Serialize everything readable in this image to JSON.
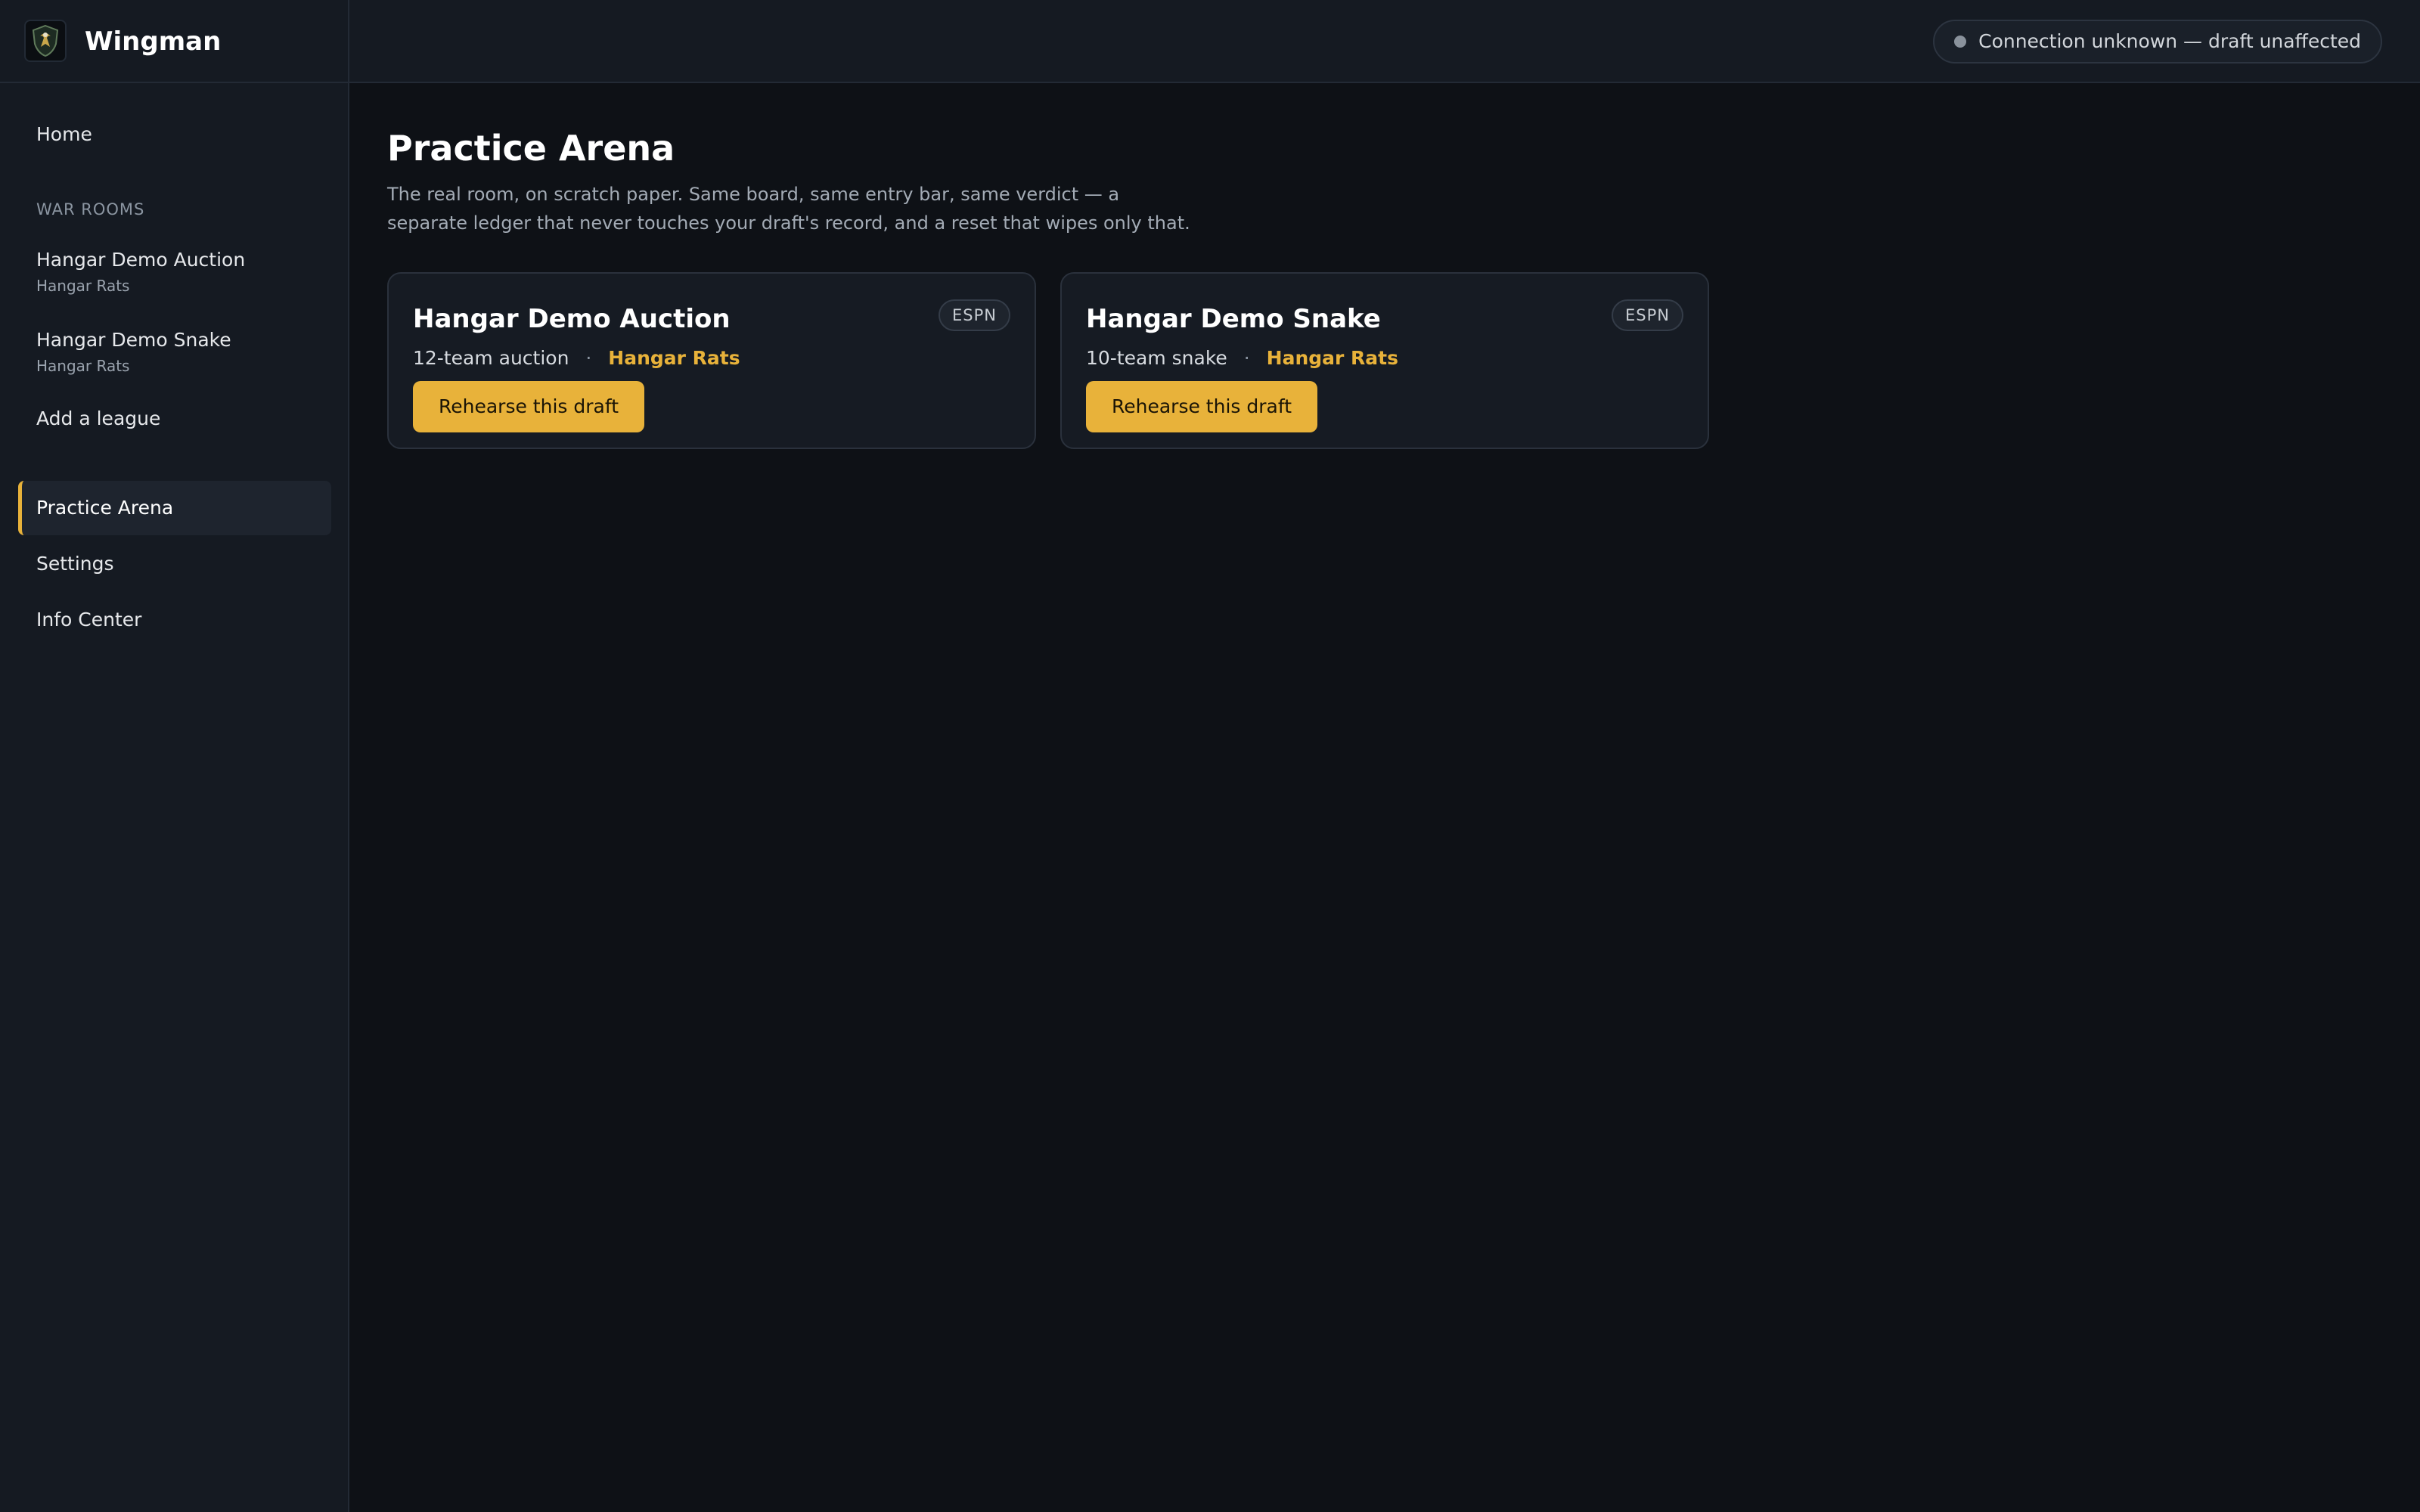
{
  "app": {
    "name": "Wingman"
  },
  "sidebar": {
    "home": "Home",
    "section_label": "WAR ROOMS",
    "war_rooms": [
      {
        "label": "Hangar Demo Auction",
        "sub": "Hangar Rats"
      },
      {
        "label": "Hangar Demo Snake",
        "sub": "Hangar Rats"
      }
    ],
    "add_league": "Add a league",
    "practice_arena": "Practice Arena",
    "settings": "Settings",
    "info_center": "Info Center"
  },
  "topbar": {
    "connection_status": "Connection unknown — draft unaffected"
  },
  "main": {
    "title": "Practice Arena",
    "description": "The real room, on scratch paper. Same board, same entry bar, same verdict — a separate ledger that never touches your draft's record, and a reset that wipes only that.",
    "cards": [
      {
        "title": "Hangar Demo Auction",
        "badge": "ESPN",
        "format": "12-team auction",
        "separator": "·",
        "team": "Hangar Rats",
        "button": "Rehearse this draft"
      },
      {
        "title": "Hangar Demo Snake",
        "badge": "ESPN",
        "format": "10-team snake",
        "separator": "·",
        "team": "Hangar Rats",
        "button": "Rehearse this draft"
      }
    ]
  },
  "colors": {
    "accent": "#e8b23a",
    "background": "#0e1116",
    "panel": "#151a22"
  }
}
